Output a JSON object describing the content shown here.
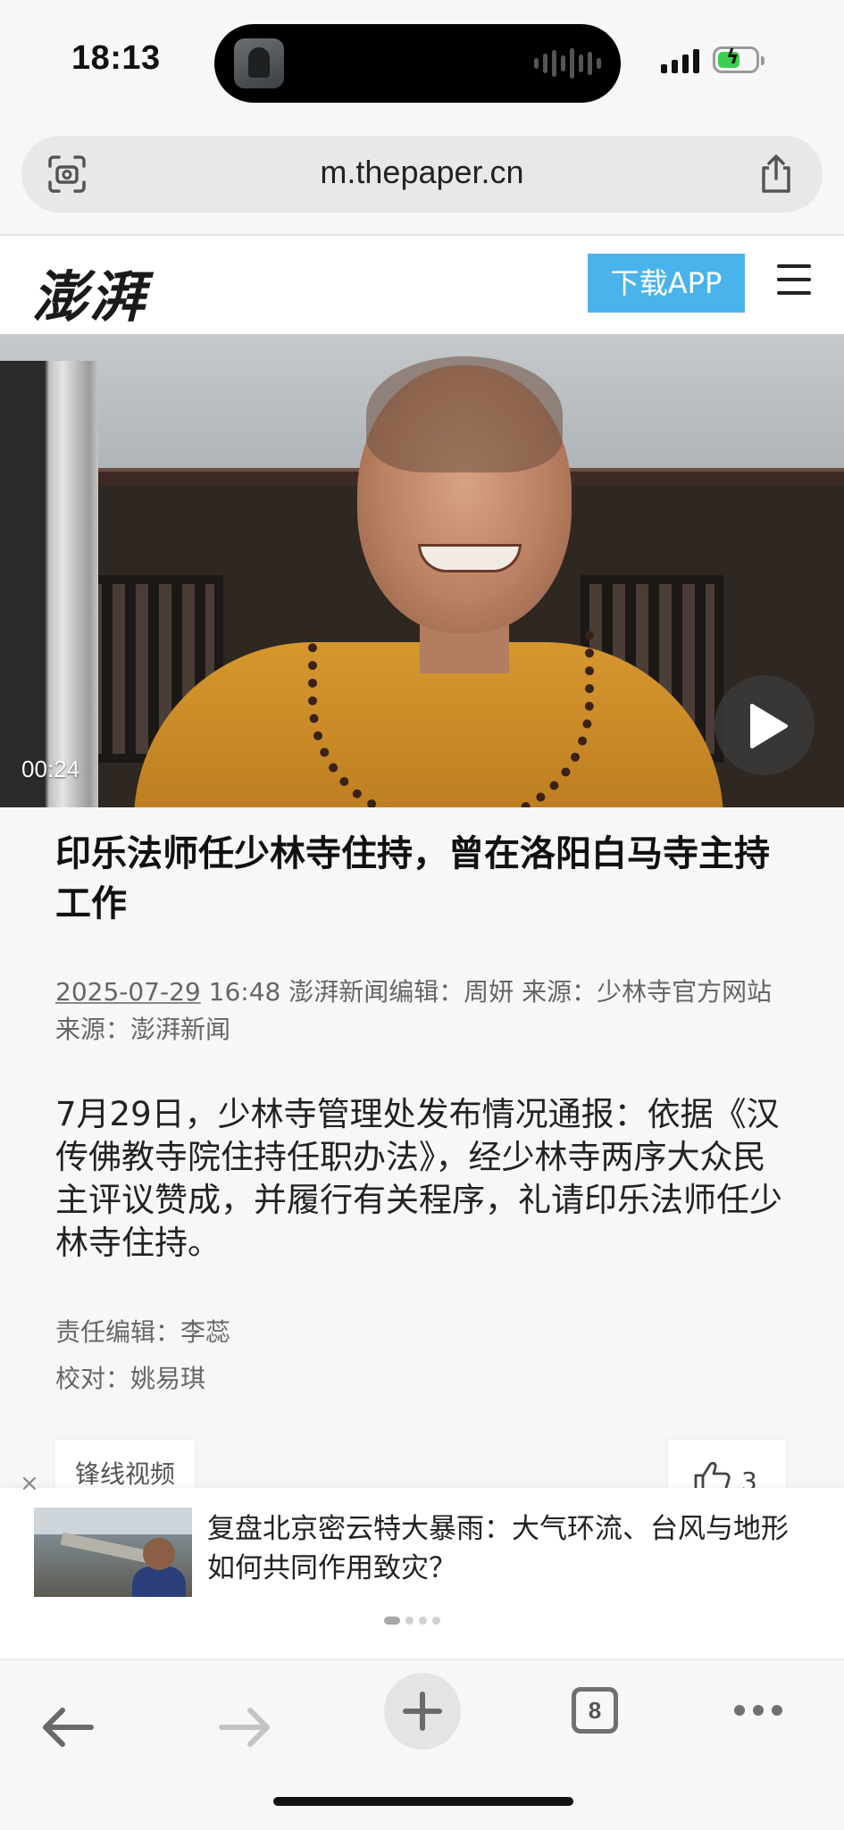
{
  "status_bar": {
    "time": "18:13"
  },
  "browser": {
    "url": "m.thepaper.cn",
    "tab_count": "8"
  },
  "site": {
    "logo": "澎湃",
    "download_label": "下载APP"
  },
  "video": {
    "duration": "00:24"
  },
  "article": {
    "title": "印乐法师任少林寺住持，曾在洛阳白马寺主持工作",
    "date": "2025-07-29",
    "time": "16:48",
    "meta_rest": "澎湃新闻编辑：周妍 来源：少林寺官方网站 来源：澎湃新闻",
    "body": "7月29日，少林寺管理处发布情况通报：依据《汉传佛教寺院住持任职办法》，经少林寺两序大众民主评议赞成，并履行有关程序，礼请印乐法师任少林寺住持。",
    "editor": "责任编辑：李蕊",
    "proofreader": "校对：姚易琪",
    "tag": "锋线视频",
    "likes": "3"
  },
  "recommendation": {
    "close_label": "×",
    "title": "复盘北京密云特大暴雨：大气环流、台风与地形如何共同作用致灾？"
  },
  "colors": {
    "accent": "#4ab3ec",
    "battery": "#3ccf4e"
  }
}
